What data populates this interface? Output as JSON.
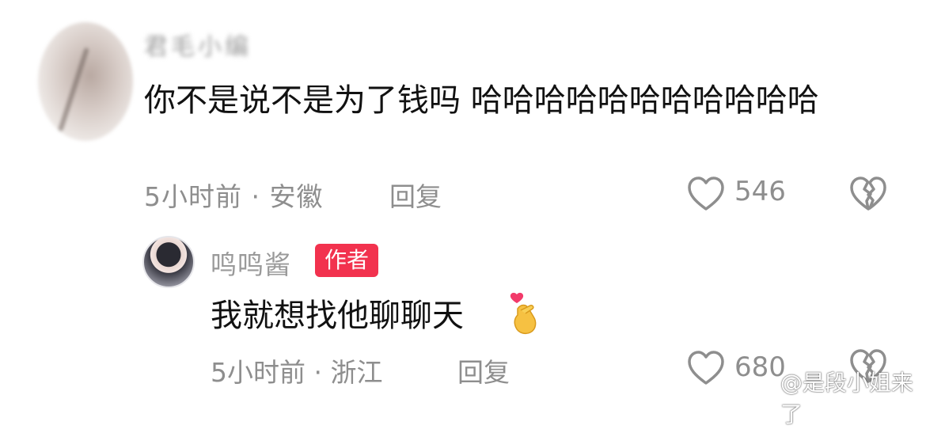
{
  "comments": [
    {
      "username": "君毛小编",
      "text": "你不是说不是为了钱吗 哈哈哈哈哈哈哈哈哈哈哈",
      "time_location": "5小时前 · 安徽",
      "reply_label": "回复",
      "likes": "546"
    },
    {
      "username": "鸣鸣酱",
      "badge": "作者",
      "text": "我就想找他聊聊天",
      "emoji": "finger-heart-emoji",
      "time_location": "5小时前 · 浙江",
      "reply_label": "回复",
      "likes": "680"
    }
  ],
  "watermark": "@是段小姐来了",
  "colors": {
    "badge_bg": "#f2324e",
    "meta_text": "#8e8e8e",
    "main_text": "#111111"
  }
}
